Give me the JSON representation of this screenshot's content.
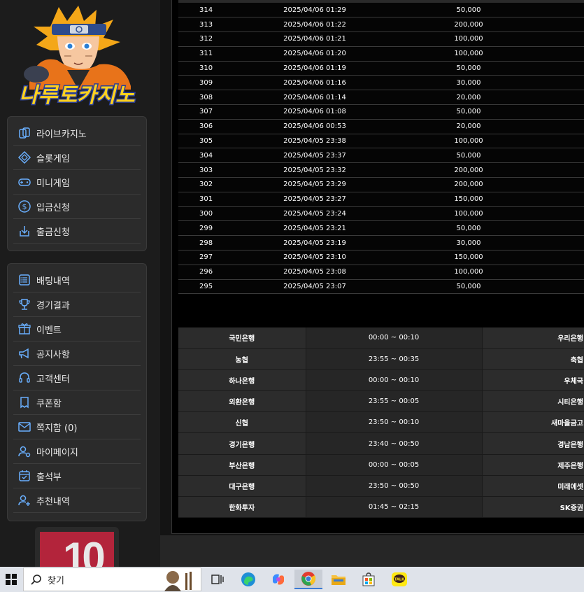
{
  "sidebar": {
    "menu1": [
      {
        "label": "라이브카지노",
        "icon": "cards-icon"
      },
      {
        "label": "슬롯게임",
        "icon": "diamond-icon"
      },
      {
        "label": "미니게임",
        "icon": "gamepad-icon"
      },
      {
        "label": "입금신청",
        "icon": "dollar-icon"
      },
      {
        "label": "출금신청",
        "icon": "withdraw-icon"
      }
    ],
    "menu2": [
      {
        "label": "배팅내역",
        "icon": "list-icon"
      },
      {
        "label": "경기결과",
        "icon": "trophy-icon"
      },
      {
        "label": "이벤트",
        "icon": "gift-icon"
      },
      {
        "label": "공지사항",
        "icon": "megaphone-icon"
      },
      {
        "label": "고객센터",
        "icon": "headset-icon"
      },
      {
        "label": "쿠폰함",
        "icon": "coupon-icon"
      },
      {
        "label": "쪽지함 (0)",
        "icon": "mail-icon"
      },
      {
        "label": "마이페이지",
        "icon": "user-gear-icon"
      },
      {
        "label": "출석부",
        "icon": "calendar-check-icon"
      },
      {
        "label": "추천내역",
        "icon": "user-plus-icon"
      }
    ]
  },
  "logo_text": "나루토카지노",
  "transactions": [
    {
      "no": "314",
      "date": "2025/04/06 01:29",
      "amount": "50,000"
    },
    {
      "no": "313",
      "date": "2025/04/06 01:22",
      "amount": "200,000"
    },
    {
      "no": "312",
      "date": "2025/04/06 01:21",
      "amount": "100,000"
    },
    {
      "no": "311",
      "date": "2025/04/06 01:20",
      "amount": "100,000"
    },
    {
      "no": "310",
      "date": "2025/04/06 01:19",
      "amount": "50,000"
    },
    {
      "no": "309",
      "date": "2025/04/06 01:16",
      "amount": "30,000"
    },
    {
      "no": "308",
      "date": "2025/04/06 01:14",
      "amount": "20,000"
    },
    {
      "no": "307",
      "date": "2025/04/06 01:08",
      "amount": "50,000"
    },
    {
      "no": "306",
      "date": "2025/04/06 00:53",
      "amount": "20,000"
    },
    {
      "no": "305",
      "date": "2025/04/05 23:38",
      "amount": "100,000"
    },
    {
      "no": "304",
      "date": "2025/04/05 23:37",
      "amount": "50,000"
    },
    {
      "no": "303",
      "date": "2025/04/05 23:32",
      "amount": "200,000"
    },
    {
      "no": "302",
      "date": "2025/04/05 23:29",
      "amount": "200,000"
    },
    {
      "no": "301",
      "date": "2025/04/05 23:27",
      "amount": "150,000"
    },
    {
      "no": "300",
      "date": "2025/04/05 23:24",
      "amount": "100,000"
    },
    {
      "no": "299",
      "date": "2025/04/05 23:21",
      "amount": "50,000"
    },
    {
      "no": "298",
      "date": "2025/04/05 23:19",
      "amount": "30,000"
    },
    {
      "no": "297",
      "date": "2025/04/05 23:10",
      "amount": "150,000"
    },
    {
      "no": "296",
      "date": "2025/04/05 23:08",
      "amount": "100,000"
    },
    {
      "no": "295",
      "date": "2025/04/05 23:07",
      "amount": "50,000"
    }
  ],
  "banks": [
    {
      "bank": "국민은행",
      "time": "00:00 ~ 00:10",
      "bank2": "우리은행"
    },
    {
      "bank": "농협",
      "time": "23:55 ~ 00:35",
      "bank2": "축협"
    },
    {
      "bank": "하나은행",
      "time": "00:00 ~ 00:10",
      "bank2": "우체국"
    },
    {
      "bank": "외환은행",
      "time": "23:55 ~ 00:05",
      "bank2": "시티은행"
    },
    {
      "bank": "신협",
      "time": "23:50 ~ 00:10",
      "bank2": "새마을금고"
    },
    {
      "bank": "경기은행",
      "time": "23:40 ~ 00:50",
      "bank2": "경남은행"
    },
    {
      "bank": "부산은행",
      "time": "00:00 ~ 00:05",
      "bank2": "제주은행"
    },
    {
      "bank": "대구은행",
      "time": "23:50 ~ 00:50",
      "bank2": "미래에셋"
    },
    {
      "bank": "한화투자",
      "time": "01:45 ~ 02:15",
      "bank2": "SK증권"
    }
  ],
  "taskbar": {
    "search_placeholder": "찾기"
  },
  "colors": {
    "accent_icon": "#6ab0ff",
    "panel_bg": "#000000",
    "sidebar_bg": "#1c1c1c"
  }
}
